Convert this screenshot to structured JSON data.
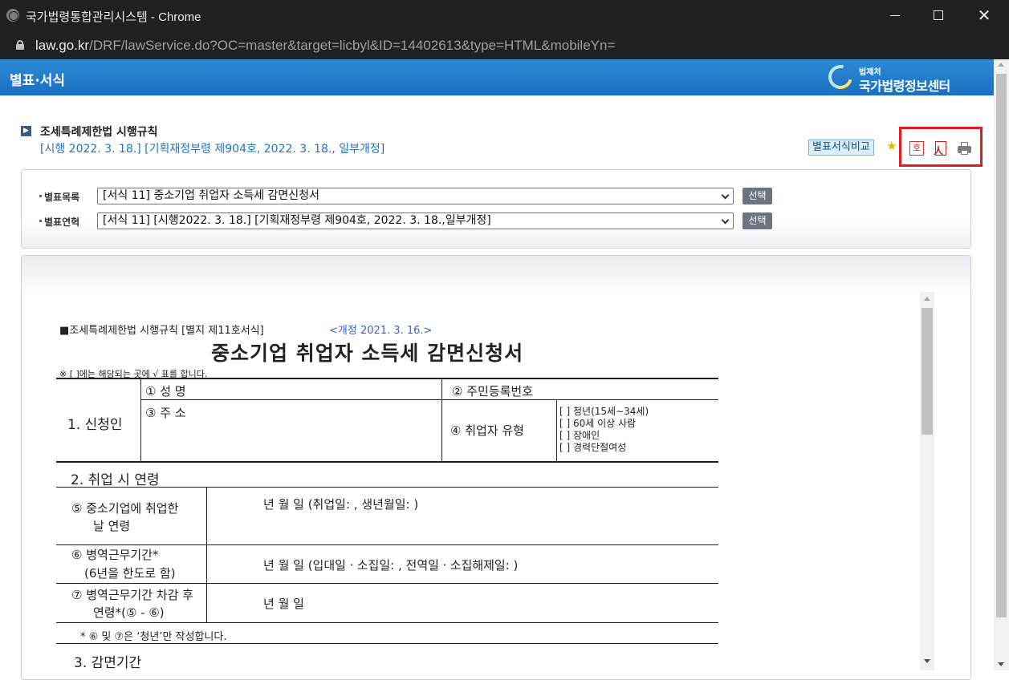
{
  "window": {
    "title": "국가법령통합관리시스템 - Chrome",
    "url_host": "law.go.kr",
    "url_path": "/DRF/lawService.do?OC=master&target=licbyl&ID=14402613&type=HTML&mobileYn="
  },
  "header": {
    "title": "별표·서식",
    "logo_small": "법제처",
    "logo_big": "국가법령정보센터"
  },
  "law": {
    "name": "조세특례제한법 시행규칙",
    "subtitle": "[시행 2022. 3. 18.] [기획재정부령 제904호, 2022. 3. 18., 일부개정]"
  },
  "toolbar": {
    "compare_label": "별표서식비교",
    "hwp_icon": "hwp-download-icon",
    "pdf_icon": "pdf-download-icon",
    "print_icon": "print-icon",
    "highlight_color": "#e21b23"
  },
  "selectors": {
    "list_label": "별표목록",
    "list_value": "[서식 11] 중소기업 취업자 소득세 감면신청서",
    "history_label": "별표연혁",
    "history_value": "[서식 11] [시행2022. 3. 18.] [기획재정부령 제904호, 2022. 3. 18.,일부개정]",
    "select_button": "선택"
  },
  "form": {
    "header": "■조세특례제한법 시행규칙 [별지 제11호서식]",
    "amend": "<개정 2021. 3. 16.>",
    "title": "중소기업 취업자 소득세 감면신청서",
    "note": "※ [   ]에는 해당되는 곳에 √ 표를 합니다.",
    "sec1": "1. 신청인",
    "f1": "① 성  명",
    "f2": "② 주민등록번호",
    "f3": "③ 주  소",
    "f4": "④ 취업자 유형",
    "types": [
      "[ ] 청년(15세∼34세)",
      "[ ] 60세 이상 사람",
      "[ ] 장애인",
      "[ ] 경력단절여성"
    ],
    "sec2": "2. 취업 시 연령",
    "f5a": "⑤ 중소기업에 취업한",
    "f5b": "날 연령",
    "f5val": "년      월      일 (취업일:                    , 생년월일:                  )",
    "f6a": "⑥ 병역근무기간*",
    "f6b": "(6년을 한도로 함)",
    "f6val": "년      월      일 (입대일ㆍ소집일:          , 전역일ㆍ소집해제일:            )",
    "f7a": "⑦ 병역근무기간 차감 후",
    "f7b": "연령*(⑤ - ⑥)",
    "f7val": "년      월      일",
    "footnote": "* ⑥ 및 ⑦은 ‘청년’만 작성합니다.",
    "sec3": "3. 감면기간"
  }
}
